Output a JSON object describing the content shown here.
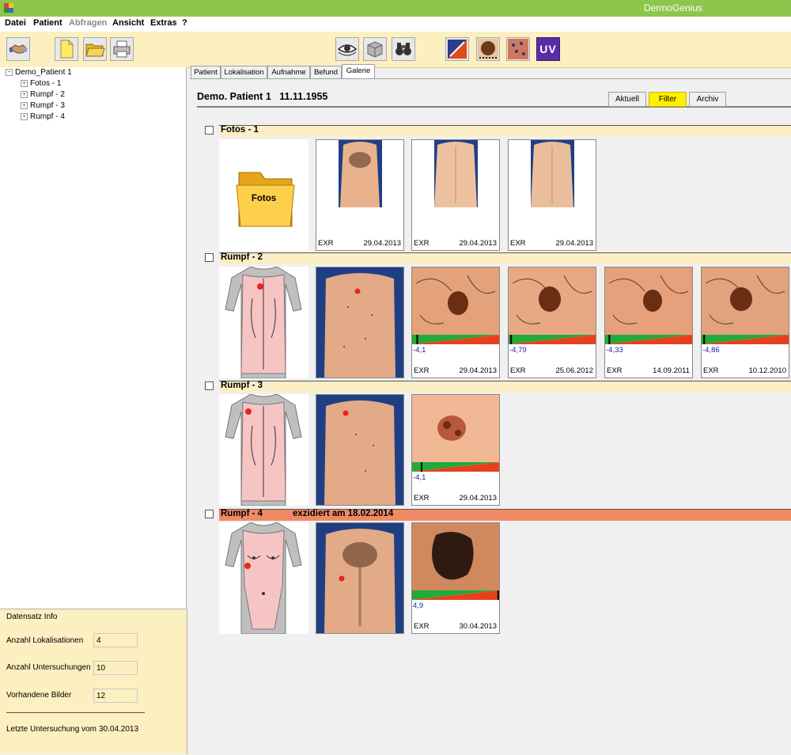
{
  "window": {
    "title": "DermoGenius"
  },
  "menu": [
    {
      "label": "Datei",
      "enabled": true
    },
    {
      "label": "Patient",
      "enabled": true
    },
    {
      "label": "Abfragen",
      "enabled": false
    },
    {
      "label": "Ansicht",
      "enabled": true
    },
    {
      "label": "Extras",
      "enabled": true
    },
    {
      "label": "?",
      "enabled": true
    }
  ],
  "toolbar": {
    "icons": [
      "handshake-icon",
      "new-document-icon",
      "open-folder-icon",
      "print-icon",
      "eye-icon",
      "cube-icon",
      "binoculars-icon",
      "draw-icon",
      "mole-icon",
      "skin-map-icon",
      "uv-icon"
    ],
    "uv_label": "UV"
  },
  "tree": {
    "root": "Demo_Patient 1",
    "items": [
      "Fotos - 1",
      "Rumpf - 2",
      "Rumpf - 3",
      "Rumpf - 4"
    ]
  },
  "info": {
    "title": "Datensatz Info",
    "localizations_label": "Anzahl Lokalisationen",
    "localizations_value": "4",
    "exams_label": "Anzahl Untersuchungen",
    "exams_value": "10",
    "images_label": "Vorhandene Bilder",
    "images_value": "12",
    "last_exam_label": "Letzte Untersuchung vom",
    "last_exam_value": "30.04.2013"
  },
  "tabs": [
    "Patient",
    "Lokalisation",
    "Aufnahme",
    "Befund",
    "Galerie"
  ],
  "active_tab": "Galerie",
  "patient_header": "Demo. Patient 1   11.11.1955",
  "filter_buttons": {
    "current": "Aktuell",
    "filter": "Filter",
    "archive": "Archiv"
  },
  "folder_label": "Fotos",
  "colors": {
    "section": "#fdefc5",
    "excised_section": "#f08a64",
    "filter_active": "#ffef00",
    "score_good": "#22aa3a",
    "score_bad": "#e8401c"
  },
  "sections": [
    {
      "title": "Fotos - 1",
      "note": "",
      "images": [
        {
          "label": "EXR",
          "date": "29.04.2013"
        },
        {
          "label": "EXR",
          "date": "29.04.2013"
        },
        {
          "label": "EXR",
          "date": "29.04.2013"
        }
      ]
    },
    {
      "title": "Rumpf - 2",
      "note": "",
      "images": [
        {
          "label": "",
          "date": ""
        },
        {
          "label": "EXR",
          "date": "29.04.2013",
          "score": "-4,1",
          "level": 0.05
        },
        {
          "label": "EXR",
          "date": "25.06.2012",
          "score": "-4,79",
          "level": 0.02
        },
        {
          "label": "EXR",
          "date": "14.09.2011",
          "score": "-4,33",
          "level": 0.04
        },
        {
          "label": "EXR",
          "date": "10.12.2010",
          "score": "-4,86",
          "level": 0.02
        }
      ]
    },
    {
      "title": "Rumpf - 3",
      "note": "",
      "images": [
        {
          "label": "",
          "date": ""
        },
        {
          "label": "EXR",
          "date": "29.04.2013",
          "score": "-4,1",
          "level": 0.1
        }
      ]
    },
    {
      "title": "Rumpf - 4",
      "note": "exzidiert am 18.02.2014",
      "images": [
        {
          "label": "",
          "date": ""
        },
        {
          "label": "EXR",
          "date": "30.04.2013",
          "score": "4,9",
          "level": 0.98
        }
      ]
    }
  ]
}
